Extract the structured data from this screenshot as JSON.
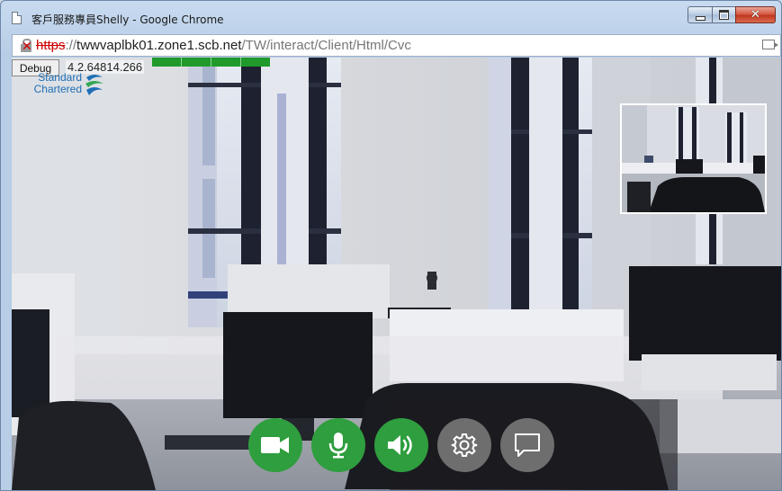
{
  "window": {
    "title": "客戶服務專員Shelly - Google Chrome"
  },
  "address": {
    "scheme": "https",
    "separator": "://",
    "host": "twwvaplbk01.zone1.scb.net",
    "path": "/TW/interact/Client/Html/Cvc"
  },
  "debug": {
    "button_label": "Debug",
    "version": "4.2.64814.266"
  },
  "logo": {
    "line1": "Standard",
    "line2": "Chartered"
  },
  "controls": [
    {
      "name": "camera",
      "icon": "video-camera-icon",
      "active": true
    },
    {
      "name": "microphone",
      "icon": "microphone-icon",
      "active": true
    },
    {
      "name": "speaker",
      "icon": "speaker-icon",
      "active": true
    },
    {
      "name": "settings",
      "icon": "gear-icon",
      "active": false
    },
    {
      "name": "chat",
      "icon": "chat-bubble-icon",
      "active": false
    }
  ],
  "colors": {
    "active_button": "#2f9e3e",
    "inactive_button": "#6e6e6e",
    "signal": "#1f9a2b",
    "brand_blue": "#1f6fb5",
    "brand_green": "#32a852"
  }
}
